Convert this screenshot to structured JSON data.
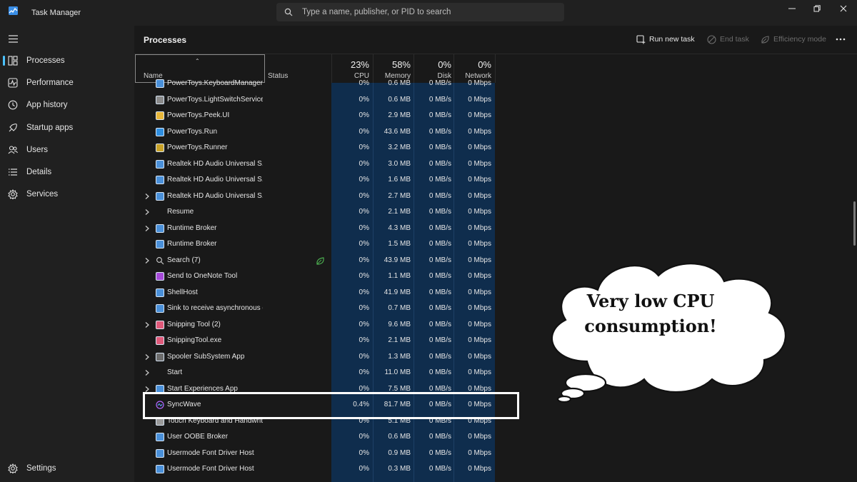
{
  "app": {
    "title": "Task Manager"
  },
  "search": {
    "placeholder": "Type a name, publisher, or PID to search"
  },
  "sidebar": {
    "items": [
      {
        "label": "Processes",
        "icon": "processes-icon",
        "active": true
      },
      {
        "label": "Performance",
        "icon": "performance-icon"
      },
      {
        "label": "App history",
        "icon": "app-history-icon"
      },
      {
        "label": "Startup apps",
        "icon": "startup-apps-icon"
      },
      {
        "label": "Users",
        "icon": "users-icon"
      },
      {
        "label": "Details",
        "icon": "details-icon"
      },
      {
        "label": "Services",
        "icon": "services-icon"
      }
    ],
    "settings_label": "Settings"
  },
  "toolbar": {
    "page_title": "Processes",
    "run_new_task": "Run new task",
    "end_task": "End task",
    "efficiency_mode": "Efficiency mode"
  },
  "columns": {
    "name": "Name",
    "status": "Status",
    "cpu": {
      "label": "CPU",
      "pct": "23%"
    },
    "memory": {
      "label": "Memory",
      "pct": "58%"
    },
    "disk": {
      "label": "Disk",
      "pct": "0%"
    },
    "network": {
      "label": "Network",
      "pct": "0%"
    }
  },
  "processes": [
    {
      "name": "PowerToys.KeyboardManager...",
      "cpu": "0%",
      "memory": "0.6 MB",
      "disk": "0 MB/s",
      "network": "0 Mbps",
      "icon": "window"
    },
    {
      "name": "PowerToys.LightSwitchService",
      "cpu": "0%",
      "memory": "0.6 MB",
      "disk": "0 MB/s",
      "network": "0 Mbps",
      "icon": "toggle"
    },
    {
      "name": "PowerToys.Peek.UI",
      "cpu": "0%",
      "memory": "2.9 MB",
      "disk": "0 MB/s",
      "network": "0 Mbps",
      "icon": "folder"
    },
    {
      "name": "PowerToys.Run",
      "cpu": "0%",
      "memory": "43.6 MB",
      "disk": "0 MB/s",
      "network": "0 Mbps",
      "icon": "run"
    },
    {
      "name": "PowerToys.Runner",
      "cpu": "0%",
      "memory": "3.2 MB",
      "disk": "0 MB/s",
      "network": "0 Mbps",
      "icon": "runner"
    },
    {
      "name": "Realtek HD Audio Universal S...",
      "cpu": "0%",
      "memory": "3.0 MB",
      "disk": "0 MB/s",
      "network": "0 Mbps",
      "icon": "window"
    },
    {
      "name": "Realtek HD Audio Universal S...",
      "cpu": "0%",
      "memory": "1.6 MB",
      "disk": "0 MB/s",
      "network": "0 Mbps",
      "icon": "window"
    },
    {
      "name": "Realtek HD Audio Universal S...",
      "cpu": "0%",
      "memory": "2.7 MB",
      "disk": "0 MB/s",
      "network": "0 Mbps",
      "icon": "window",
      "expandable": true
    },
    {
      "name": "Resume",
      "cpu": "0%",
      "memory": "2.1 MB",
      "disk": "0 MB/s",
      "network": "0 Mbps",
      "icon": "none",
      "expandable": true
    },
    {
      "name": "Runtime Broker",
      "cpu": "0%",
      "memory": "4.3 MB",
      "disk": "0 MB/s",
      "network": "0 Mbps",
      "icon": "window",
      "expandable": true
    },
    {
      "name": "Runtime Broker",
      "cpu": "0%",
      "memory": "1.5 MB",
      "disk": "0 MB/s",
      "network": "0 Mbps",
      "icon": "window"
    },
    {
      "name": "Search (7)",
      "cpu": "0%",
      "memory": "43.9 MB",
      "disk": "0 MB/s",
      "network": "0 Mbps",
      "icon": "search",
      "expandable": true,
      "efficiency": true
    },
    {
      "name": "Send to OneNote Tool",
      "cpu": "0%",
      "memory": "1.1 MB",
      "disk": "0 MB/s",
      "network": "0 Mbps",
      "icon": "onenote"
    },
    {
      "name": "ShellHost",
      "cpu": "0%",
      "memory": "41.9 MB",
      "disk": "0 MB/s",
      "network": "0 Mbps",
      "icon": "window"
    },
    {
      "name": "Sink to receive asynchronous c...",
      "cpu": "0%",
      "memory": "0.7 MB",
      "disk": "0 MB/s",
      "network": "0 Mbps",
      "icon": "window"
    },
    {
      "name": "Snipping Tool (2)",
      "cpu": "0%",
      "memory": "9.6 MB",
      "disk": "0 MB/s",
      "network": "0 Mbps",
      "icon": "snip",
      "expandable": true
    },
    {
      "name": "SnippingTool.exe",
      "cpu": "0%",
      "memory": "2.1 MB",
      "disk": "0 MB/s",
      "network": "0 Mbps",
      "icon": "snip"
    },
    {
      "name": "Spooler SubSystem App",
      "cpu": "0%",
      "memory": "1.3 MB",
      "disk": "0 MB/s",
      "network": "0 Mbps",
      "icon": "spooler",
      "expandable": true
    },
    {
      "name": "Start",
      "cpu": "0%",
      "memory": "11.0 MB",
      "disk": "0 MB/s",
      "network": "0 Mbps",
      "icon": "none",
      "expandable": true
    },
    {
      "name": "Start Experiences App",
      "cpu": "0%",
      "memory": "7.5 MB",
      "disk": "0 MB/s",
      "network": "0 Mbps",
      "icon": "window",
      "expandable": true
    },
    {
      "name": "SyncWave",
      "cpu": "0.4%",
      "memory": "81.7 MB",
      "disk": "0 MB/s",
      "network": "0 Mbps",
      "icon": "syncwave"
    },
    {
      "name": "Touch Keyboard and Handwrit...",
      "cpu": "0%",
      "memory": "5.1 MB",
      "disk": "0 MB/s",
      "network": "0 Mbps",
      "icon": "keyboard"
    },
    {
      "name": "User OOBE Broker",
      "cpu": "0%",
      "memory": "0.6 MB",
      "disk": "0 MB/s",
      "network": "0 Mbps",
      "icon": "window"
    },
    {
      "name": "Usermode Font Driver Host",
      "cpu": "0%",
      "memory": "0.9 MB",
      "disk": "0 MB/s",
      "network": "0 Mbps",
      "icon": "window"
    },
    {
      "name": "Usermode Font Driver Host",
      "cpu": "0%",
      "memory": "0.3 MB",
      "disk": "0 MB/s",
      "network": "0 Mbps",
      "icon": "window"
    }
  ],
  "annotation": {
    "line1": "Very low CPU",
    "line2": "consumption!"
  },
  "colors": {
    "accent": "#4cc2ff",
    "heat": "#0f2d4d",
    "highlight": "#ffffff"
  }
}
